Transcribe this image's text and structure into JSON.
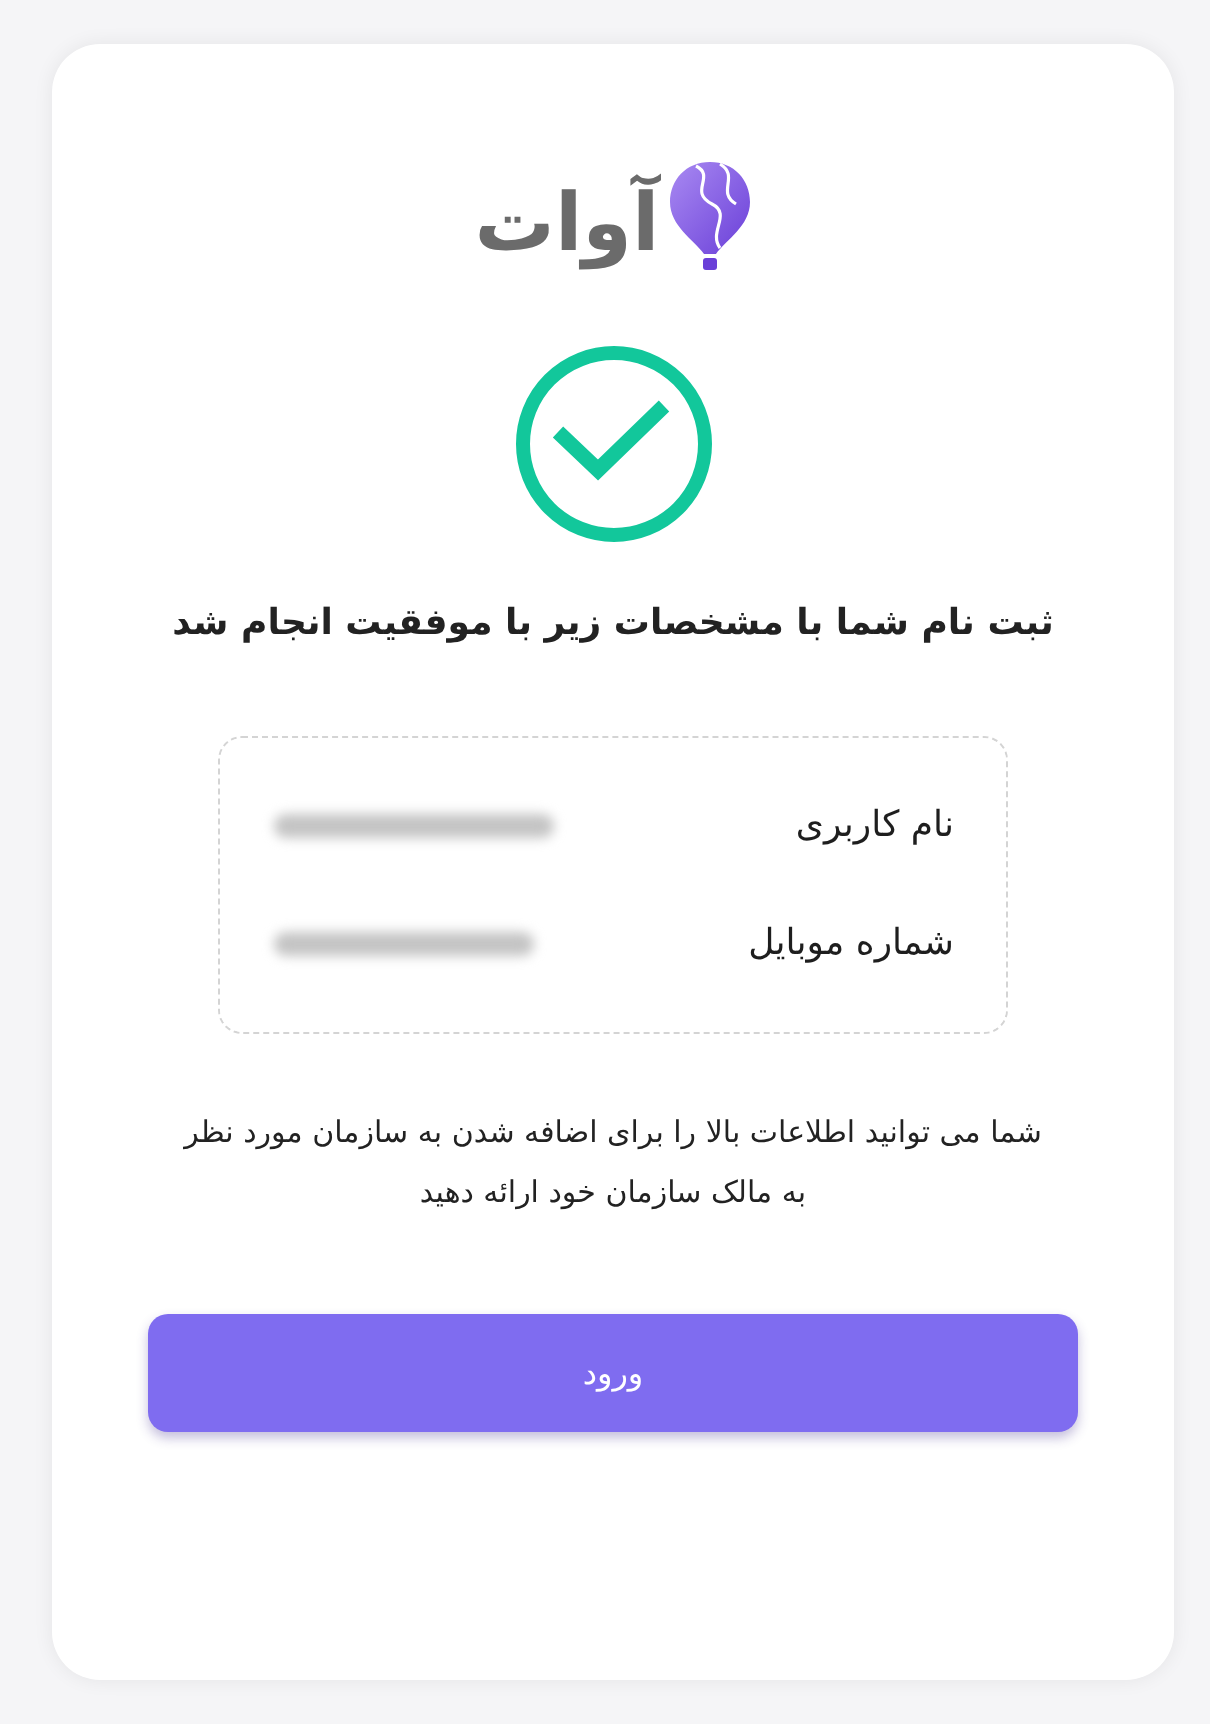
{
  "logo": {
    "text": "آوات"
  },
  "title": "ثبت نام شما با مشخصات زیر با موفقیت انجام شد",
  "details": [
    {
      "label": "نام کاربری"
    },
    {
      "label": "شماره موبایل"
    }
  ],
  "note": "شما می توانید اطلاعات بالا را برای اضافه شدن به سازمان مورد نظر به مالک سازمان خود ارائه دهید",
  "button": {
    "label": "ورود"
  }
}
